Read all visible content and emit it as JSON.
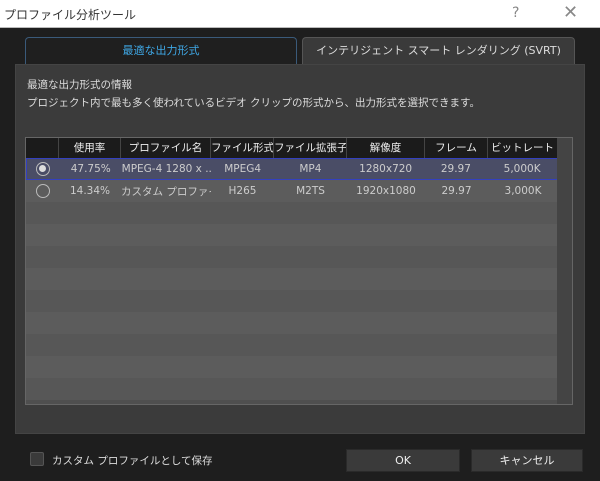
{
  "window": {
    "title": "プロファイル分析ツール",
    "help": "?",
    "close": "✕"
  },
  "tabs": [
    {
      "label": "最適な出力形式"
    },
    {
      "label": "インテリジェント スマート レンダリング (SVRT)"
    }
  ],
  "info": {
    "heading": "最適な出力形式の情報",
    "description": "プロジェクト内で最も多く使われているビデオ クリップの形式から、出力形式を選択できます。"
  },
  "table": {
    "columns": [
      "",
      "使用率",
      "プロファイル名",
      "ファイル形式",
      "ファイル拡張子",
      "解像度",
      "フレーム",
      "ビットレート"
    ],
    "rows": [
      {
        "selected": true,
        "usage": "47.75%",
        "profile": "MPEG-4 1280 x ...",
        "format": "MPEG4",
        "ext": "MP4",
        "resolution": "1280x720",
        "frame": "29.97",
        "bitrate": "5,000K"
      },
      {
        "selected": false,
        "usage": "14.34%",
        "profile": "カスタム プロファイル",
        "format": "H265",
        "ext": "M2TS",
        "resolution": "1920x1080",
        "frame": "29.97",
        "bitrate": "3,000K"
      }
    ]
  },
  "footer": {
    "save_custom": "カスタム プロファイルとして保存",
    "ok": "OK",
    "cancel": "キャンセル"
  }
}
